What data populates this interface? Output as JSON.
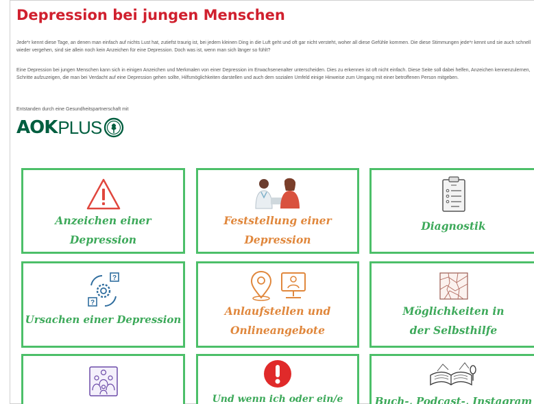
{
  "page": {
    "title": "Depression bei jungen Menschen",
    "intro_1": "Jede*r kennt diese Tage, an denen man einfach auf nichts Lust hat, zutiefst traurig ist, bei jedem kleinen Ding in die Luft geht und oft gar nicht versteht, woher all diese Gefühle kommen. Die diese Stimmungen jede*r kennt und sie auch schnell wieder vergehen, sind sie allein noch kein Anzeichen für eine Depression. Doch was ist, wenn man sich länger so fühlt?",
    "intro_2": "Eine Depression bei jungen Menschen kann sich in einigen Anzeichen und Merkmalen von einer Depression im Erwachsenenalter unterscheiden. Dies zu erkennen ist oft nicht einfach. Diese Seite soll dabei helfen, Anzeichen kennenzulernen, Schritte aufzuzeigen, die man bei Verdacht auf eine Depression gehen sollte, Hilfsmöglichkeiten darstellen und auch dem sozialen Umfeld einige Hinweise zum Umgang mit einer betroffenen Person mitgeben.",
    "credit": "Entstanden durch eine Gesundheitspartnerschaft mit",
    "logo_text_bold": "AOK",
    "logo_text_light": "PLUS"
  },
  "colors": {
    "title_red": "#d0202e",
    "tile_border": "#4cbf69",
    "tile_text_green": "#3da95a",
    "tile_text_orange": "#e0873c",
    "aok_green": "#005e3f"
  },
  "tiles": [
    {
      "label_line1": "Anzeichen einer",
      "label_line2": "Depression",
      "icon": "warning-triangle-icon"
    },
    {
      "label_line1": "Feststellung einer",
      "label_line2": "Depression",
      "icon": "doctor-consultation-icon"
    },
    {
      "label_line1": "Diagnostik",
      "label_line2": "",
      "icon": "clipboard-checklist-icon"
    },
    {
      "label_line1": "Ursachen einer Depression",
      "label_line2": "",
      "icon": "gear-question-cycle-icon"
    },
    {
      "label_line1": "Anlaufstellen und",
      "label_line2": "Onlineangebote",
      "icon": "location-and-video-call-icon"
    },
    {
      "label_line1": "Möglichkeiten in",
      "label_line2": "der Selbsthilfe",
      "icon": "network-web-icon"
    },
    {
      "label_line1": "",
      "label_line2": "",
      "icon": "group-of-people-icon"
    },
    {
      "label_line1": "Und wenn ich oder ein/e",
      "label_line2": "",
      "icon": "exclamation-circle-icon"
    },
    {
      "label_line1": "Buch-, Podcast-, Instagram",
      "label_line2": "",
      "icon": "book-and-microphone-icon"
    }
  ]
}
